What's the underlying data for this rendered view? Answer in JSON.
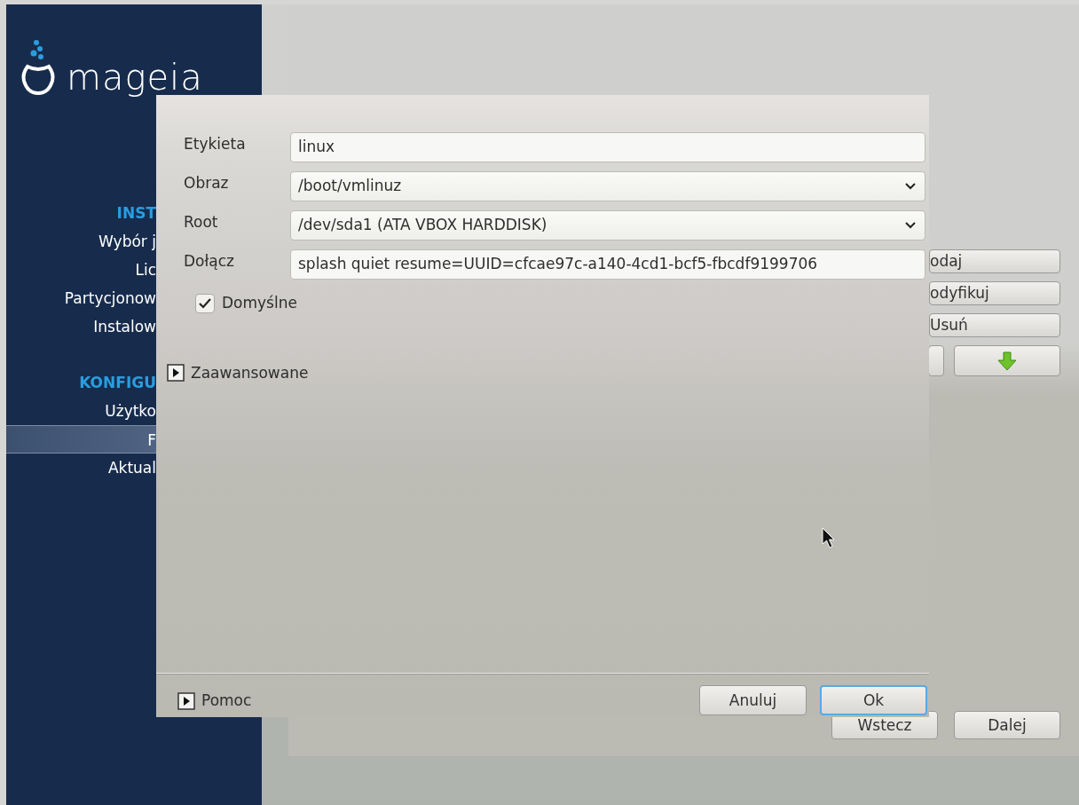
{
  "sidebar": {
    "logo_text": "mageia",
    "sections": [
      {
        "title": "INST",
        "items": [
          {
            "label": "Wybór j",
            "selected": false
          },
          {
            "label": "Lic",
            "selected": false
          },
          {
            "label": "Partycjonow",
            "selected": false
          },
          {
            "label": "Instalow",
            "selected": false
          }
        ]
      },
      {
        "title": "KONFIGU",
        "items": [
          {
            "label": "Użytko",
            "selected": false
          },
          {
            "label": "F",
            "selected": true
          },
          {
            "label": "Aktual",
            "selected": false
          }
        ]
      }
    ]
  },
  "side_buttons": [
    {
      "kind": "text",
      "label": "odaj"
    },
    {
      "kind": "text",
      "label": "odyfikuj"
    },
    {
      "kind": "text",
      "label": "Usuń"
    },
    {
      "kind": "arrows"
    }
  ],
  "nav_buttons": [
    {
      "label": "Wstecz"
    },
    {
      "label": "Dalej"
    }
  ],
  "dialog": {
    "fields": [
      {
        "kind": "text",
        "label": "Etykieta",
        "value": "linux"
      },
      {
        "kind": "select",
        "label": "Obraz",
        "value": "/boot/vmlinuz"
      },
      {
        "kind": "select",
        "label": "Root",
        "value": "/dev/sda1 (ATA VBOX HARDDISK)"
      },
      {
        "kind": "text",
        "label": "Dołącz",
        "value": "splash quiet resume=UUID=cfcae97c-a140-4cd1-bcf5-fbcdf9199706"
      }
    ],
    "default_checkbox": {
      "label": "Domyślne",
      "checked": true
    },
    "advanced": {
      "label": "Zaawansowane",
      "expanded": false
    },
    "help": {
      "label": "Pomoc",
      "expanded": false
    },
    "buttons": [
      {
        "label": "Anuluj",
        "focused": false
      },
      {
        "label": "Ok",
        "focused": true
      }
    ]
  }
}
